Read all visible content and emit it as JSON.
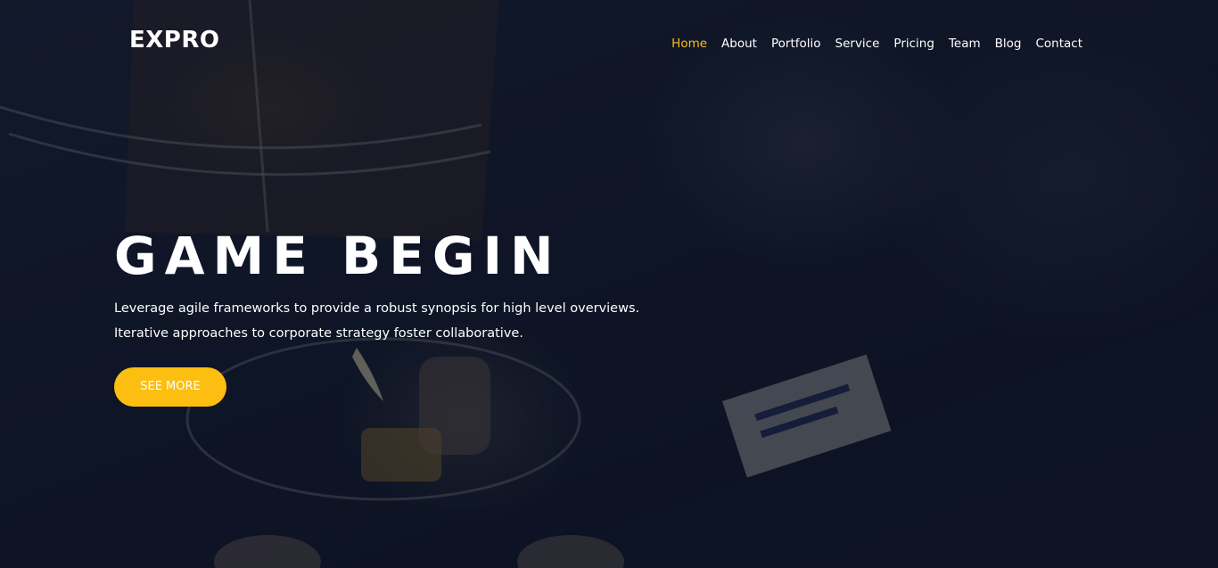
{
  "header": {
    "logo": "EXPRO",
    "nav": [
      {
        "label": "Home",
        "active": true
      },
      {
        "label": "About",
        "active": false
      },
      {
        "label": "Portfolio",
        "active": false
      },
      {
        "label": "Service",
        "active": false
      },
      {
        "label": "Pricing",
        "active": false
      },
      {
        "label": "Team",
        "active": false
      },
      {
        "label": "Blog",
        "active": false
      },
      {
        "label": "Contact",
        "active": false
      }
    ]
  },
  "hero": {
    "title": "GAME BEGIN",
    "line1": "Leverage agile frameworks to provide a robust synopsis for high level overviews.",
    "line2": "Iterative approaches to corporate strategy foster collaborative.",
    "cta_label": "SEE MORE"
  },
  "colors": {
    "accent": "#fdbe12",
    "overlay": "#0c1222",
    "text": "#ffffff"
  }
}
